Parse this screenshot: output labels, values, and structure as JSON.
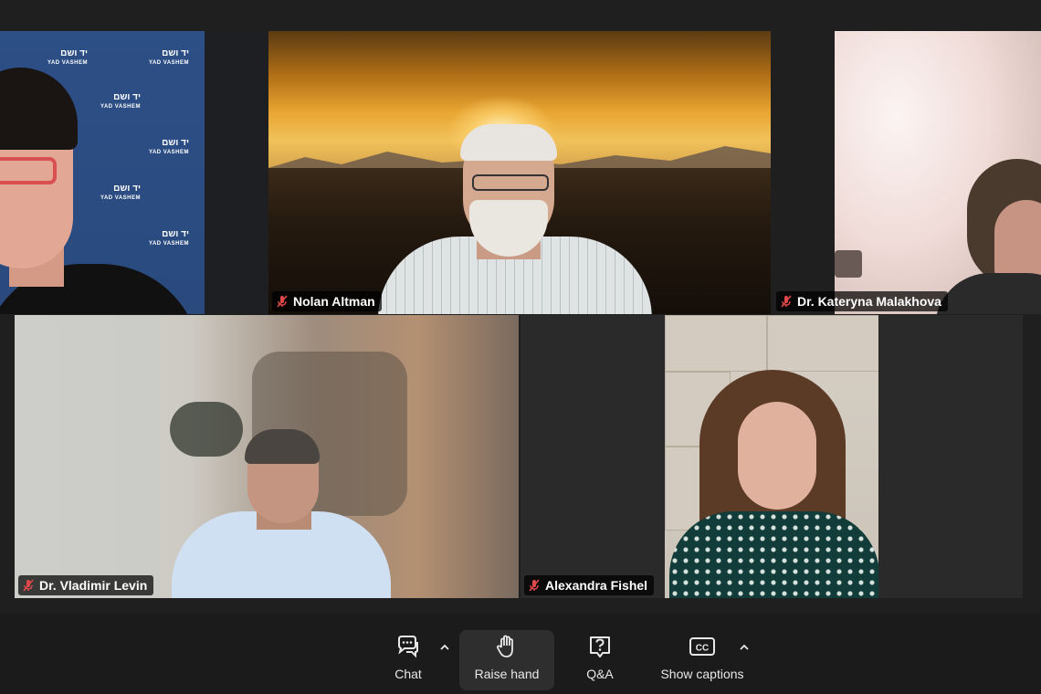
{
  "window": {
    "app": "Zoom Meeting",
    "view": "Gallery View"
  },
  "participants": [
    {
      "name": "",
      "muted": false,
      "active_speaker": true,
      "background": "Yad Vashem backdrop"
    },
    {
      "name": "Nolan Altman",
      "muted": true,
      "active_speaker": false
    },
    {
      "name": "Dr. Kateryna Malakhova",
      "muted": true,
      "active_speaker": false
    },
    {
      "name": "Dr. Vladimir Levin",
      "muted": true,
      "active_speaker": false
    },
    {
      "name": "Alexandra Fishel",
      "muted": true,
      "active_speaker": false
    }
  ],
  "backdrop": {
    "logo_hebrew": "יד ושם",
    "logo_latin": "YAD VASHEM"
  },
  "toolbar": {
    "chat_label": "Chat",
    "raise_hand_label": "Raise hand",
    "qa_label": "Q&A",
    "captions_label": "Show captions",
    "cc_text": "CC"
  },
  "colors": {
    "active_speaker_border": "#3fc860",
    "background": "#1f1f1f",
    "muted_icon": "#e0484a",
    "name_tag_text": "#ffffff"
  },
  "icons": [
    "muted-mic-icon",
    "chat-icon",
    "chevron-up-icon",
    "raise-hand-icon",
    "question-icon",
    "closed-captions-icon"
  ]
}
